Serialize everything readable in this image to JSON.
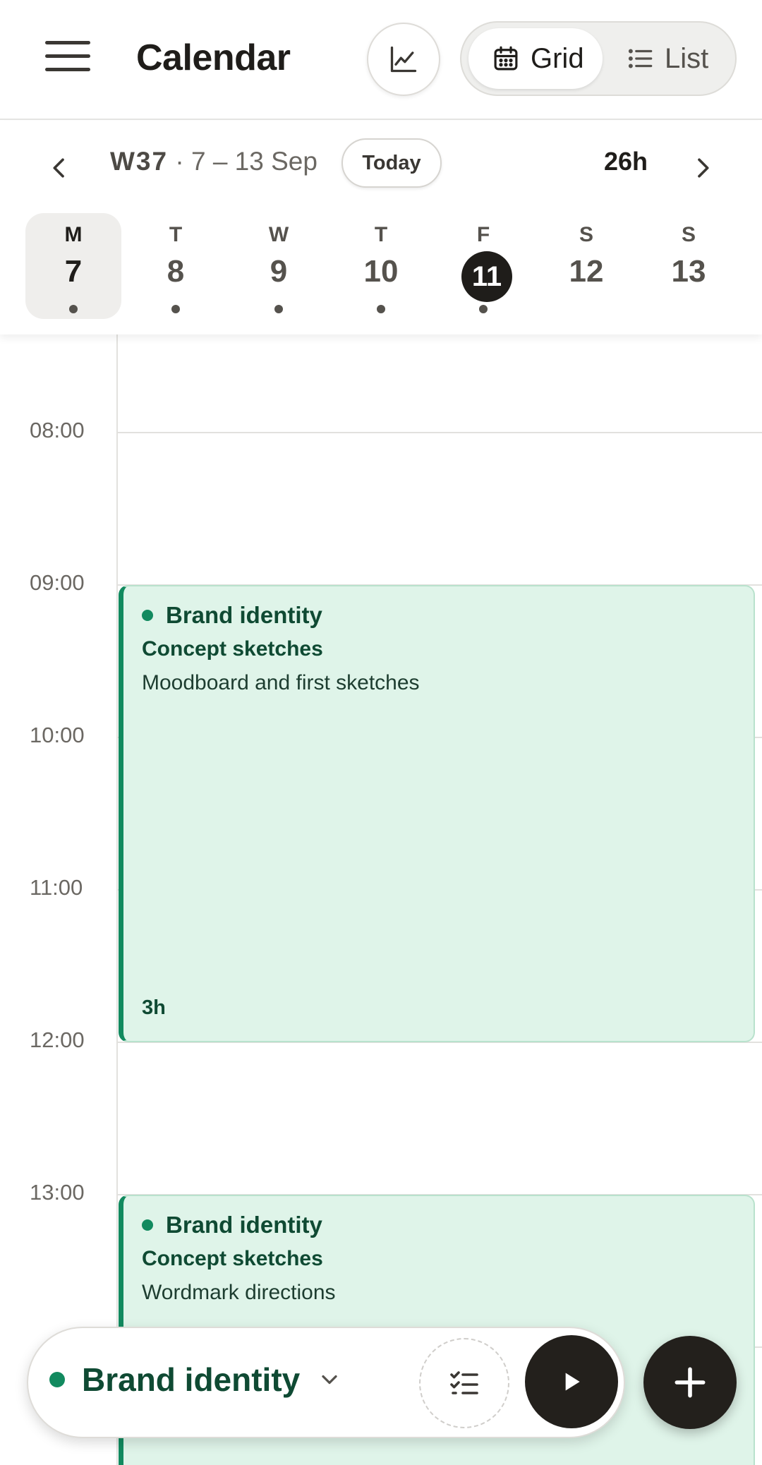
{
  "header": {
    "title": "Calendar",
    "stats_icon": "chart-line-icon",
    "menu_icon": "hamburger-menu-icon",
    "view_toggle": {
      "selected": "Grid",
      "options": [
        {
          "label": "Grid",
          "icon": "calendar-grid-icon"
        },
        {
          "label": "List",
          "icon": "list-icon"
        }
      ]
    }
  },
  "week": {
    "number": "W37",
    "range": "· 7 – 13 Sep",
    "today_label": "Today",
    "total_hours": "26h",
    "days": [
      {
        "name": "M",
        "num": "7",
        "selected": true,
        "today": false,
        "has_entries": true
      },
      {
        "name": "T",
        "num": "8",
        "selected": false,
        "today": false,
        "has_entries": true
      },
      {
        "name": "W",
        "num": "9",
        "selected": false,
        "today": false,
        "has_entries": true
      },
      {
        "name": "T",
        "num": "10",
        "selected": false,
        "today": false,
        "has_entries": true
      },
      {
        "name": "F",
        "num": "11",
        "selected": false,
        "today": true,
        "has_entries": true
      },
      {
        "name": "S",
        "num": "12",
        "selected": false,
        "today": false,
        "has_entries": false
      },
      {
        "name": "S",
        "num": "13",
        "selected": false,
        "today": false,
        "has_entries": false
      }
    ]
  },
  "timeline": {
    "hours": [
      "08:00",
      "09:00",
      "10:00",
      "11:00",
      "12:00",
      "13:00"
    ],
    "events": [
      {
        "project": "Brand identity",
        "title": "Concept sketches",
        "description": "Moodboard and first sketches",
        "duration": "3h",
        "start": "09:00",
        "end": "12:00"
      },
      {
        "project": "Brand identity",
        "title": "Concept sketches",
        "description": "Wordmark directions",
        "duration": "",
        "start": "13:00",
        "end": ""
      }
    ]
  },
  "timer_bar": {
    "project": "Brand identity",
    "project_color": "#128a5f",
    "tasks_icon": "checklist-icon",
    "play_icon": "play-icon",
    "add_icon": "plus-icon"
  },
  "colors": {
    "accent": "#128a5f",
    "event_bg": "#dff4e9",
    "dark": "#23201c"
  }
}
